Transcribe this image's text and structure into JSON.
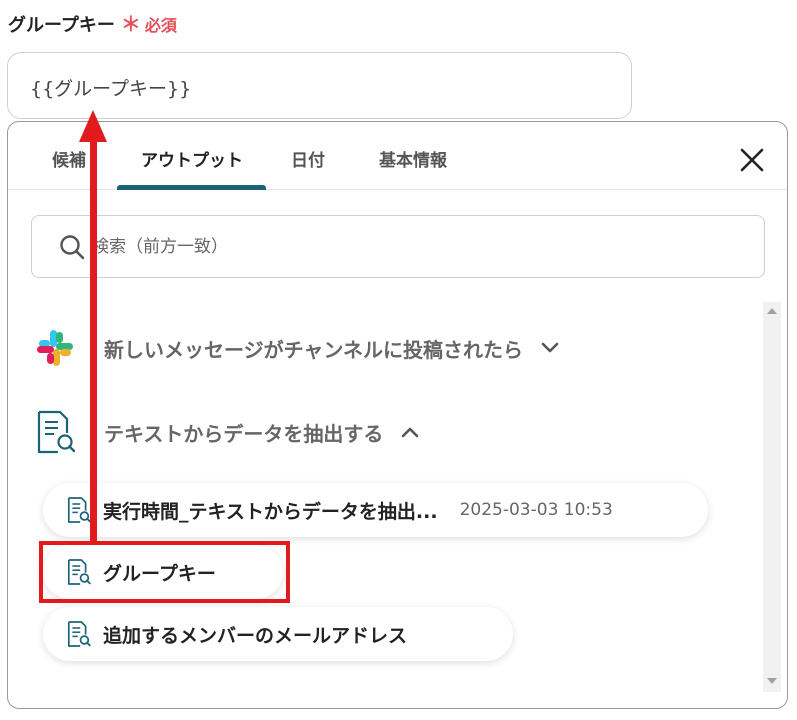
{
  "field": {
    "label": "グループキー",
    "required_mark": "＊",
    "required_text": "必須",
    "value": "{{グループキー}}"
  },
  "tabs": [
    {
      "label": "候補",
      "active": false
    },
    {
      "label": "アウトプット",
      "active": true
    },
    {
      "label": "日付",
      "active": false
    },
    {
      "label": "基本情報",
      "active": false
    }
  ],
  "search": {
    "placeholder": "検索（前方一致）"
  },
  "sections": [
    {
      "label": "新しいメッセージがチャンネルに投稿されたら",
      "icon": "slack-icon",
      "expanded": false
    },
    {
      "label": "テキストからデータを抽出する",
      "icon": "document-search-icon",
      "expanded": true
    }
  ],
  "items": [
    {
      "label": "実行時間_テキストからデータを抽出...",
      "meta": "2025-03-03 10:53",
      "icon": "document-search-icon"
    },
    {
      "label": "グループキー",
      "meta": "",
      "icon": "document-search-icon"
    },
    {
      "label": "追加するメンバーのメールアドレス",
      "meta": "",
      "icon": "document-search-icon"
    }
  ],
  "colors": {
    "accent": "#1d6377",
    "required": "#e4505a",
    "annotation": "#e2191d"
  }
}
